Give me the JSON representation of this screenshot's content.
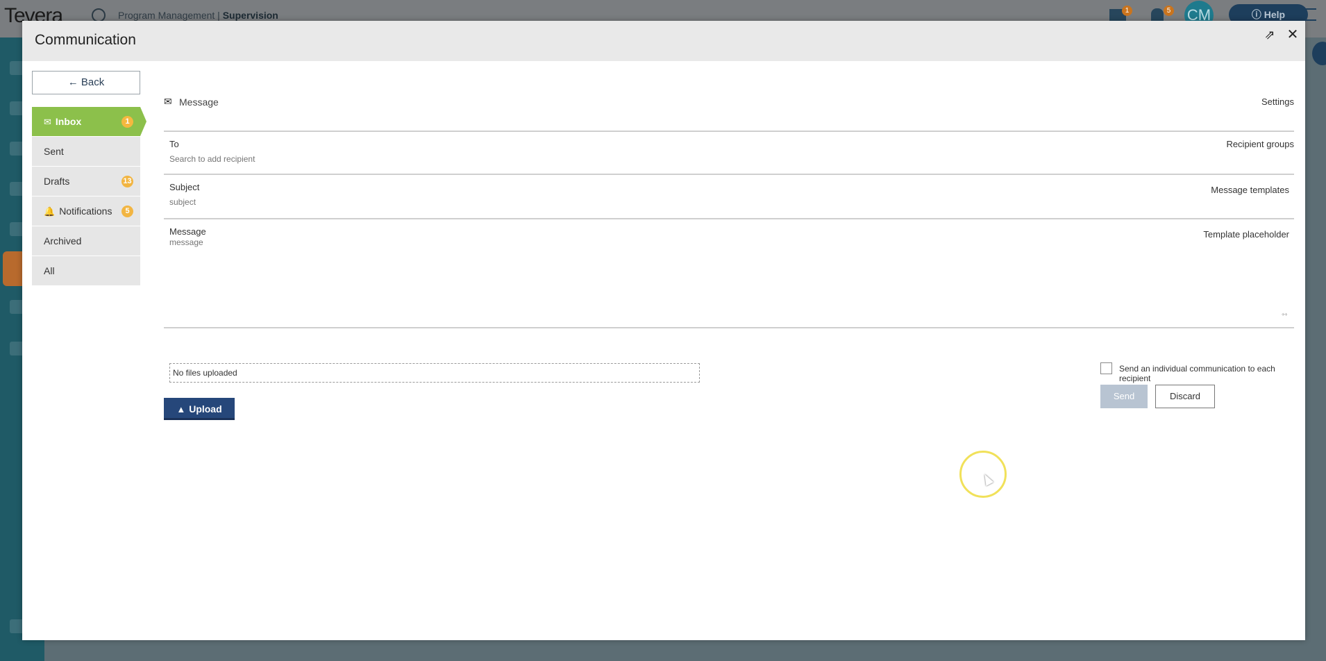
{
  "app": {
    "logo_text": "Tevera",
    "breadcrumb_prefix": "Program Management | ",
    "breadcrumb_current": "Supervision",
    "mail_badge": "1",
    "bell_badge": "5",
    "avatar_initials": "CM",
    "help_label": "Help"
  },
  "modal": {
    "title": "Communication",
    "back_label": "Back",
    "nav": [
      {
        "label": "Inbox",
        "badge": "1"
      },
      {
        "label": "Sent",
        "badge": ""
      },
      {
        "label": "Drafts",
        "badge": "13"
      },
      {
        "label": "Notifications",
        "badge": "5"
      },
      {
        "label": "Archived",
        "badge": ""
      },
      {
        "label": "All",
        "badge": ""
      }
    ]
  },
  "compose": {
    "header_label": "Message",
    "settings_label": "Settings",
    "to_label": "To",
    "to_placeholder": "Search to add recipient",
    "recipient_groups_label": "Recipient groups",
    "subject_label": "Subject",
    "subject_placeholder": "subject",
    "message_templates_label": "Message templates",
    "message_label": "Message",
    "message_placeholder": "message",
    "template_placeholder_label": "Template placeholder",
    "files_status": "No files uploaded",
    "upload_label": "Upload",
    "individual_checkbox_label": "Send an individual communication to each recipient",
    "send_label": "Send",
    "discard_label": "Discard"
  },
  "colors": {
    "accent_green": "#8cc04b",
    "upload_blue": "#26477a",
    "badge_orange": "#f2b542"
  }
}
